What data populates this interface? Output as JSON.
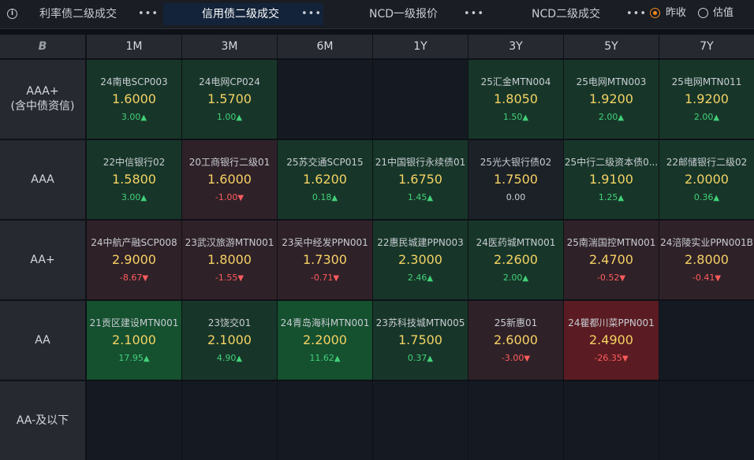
{
  "tabs": [
    {
      "label": "利率债二级成交",
      "more": "•••"
    },
    {
      "label": "信用债二级成交",
      "more": "•••",
      "active": true
    },
    {
      "label": "NCD一级报价",
      "more": "•••"
    },
    {
      "label": "NCD二级成交",
      "more": "•••"
    }
  ],
  "radio": {
    "option1": "昨收",
    "option2": "估值",
    "selected": "昨收"
  },
  "header": {
    "logo": "B",
    "terms": [
      "1M",
      "3M",
      "6M",
      "1Y",
      "3Y",
      "5Y",
      "7Y"
    ]
  },
  "rows": [
    {
      "label_line1": "AAA+",
      "label_line2": "(含中债资信)",
      "cells": [
        {
          "name": "24南电SCP003",
          "rate": "1.6000",
          "change": "3.00",
          "dir": "up"
        },
        {
          "name": "24电网CP024",
          "rate": "1.5700",
          "change": "1.00",
          "dir": "up"
        },
        null,
        null,
        {
          "name": "25汇金MTN004",
          "rate": "1.8050",
          "change": "1.50",
          "dir": "up"
        },
        {
          "name": "25电网MTN003",
          "rate": "1.9200",
          "change": "2.00",
          "dir": "up"
        },
        {
          "name": "25电网MTN011",
          "rate": "1.9200",
          "change": "2.00",
          "dir": "up"
        }
      ]
    },
    {
      "label_line1": "AAA",
      "label_line2": "",
      "cells": [
        {
          "name": "22中信银行02",
          "rate": "1.5800",
          "change": "3.00",
          "dir": "up"
        },
        {
          "name": "20工商银行二级01",
          "rate": "1.6000",
          "change": "-1.00",
          "dir": "down"
        },
        {
          "name": "25苏交通SCP015",
          "rate": "1.6200",
          "change": "0.18",
          "dir": "up"
        },
        {
          "name": "21中国银行永续债01",
          "rate": "1.6750",
          "change": "1.45",
          "dir": "up"
        },
        {
          "name": "25光大银行债02",
          "rate": "1.7500",
          "change": "0.00",
          "dir": "flat"
        },
        {
          "name": "25中行二级资本债0...",
          "rate": "1.9100",
          "change": "1.25",
          "dir": "up"
        },
        {
          "name": "22邮储银行二级02",
          "rate": "2.0000",
          "change": "0.36",
          "dir": "up"
        }
      ]
    },
    {
      "label_line1": "AA+",
      "label_line2": "",
      "cells": [
        {
          "name": "24中航产融SCP008",
          "rate": "2.9000",
          "change": "-8.67",
          "dir": "down"
        },
        {
          "name": "23武汉旅游MTN001",
          "rate": "1.8000",
          "change": "-1.55",
          "dir": "down"
        },
        {
          "name": "23吴中经发PPN001",
          "rate": "1.7300",
          "change": "-0.71",
          "dir": "down"
        },
        {
          "name": "22惠民城建PPN003",
          "rate": "2.3000",
          "change": "2.46",
          "dir": "up"
        },
        {
          "name": "24医药城MTN001",
          "rate": "2.2600",
          "change": "2.00",
          "dir": "up"
        },
        {
          "name": "25南湍国控MTN001",
          "rate": "2.4700",
          "change": "-0.52",
          "dir": "down"
        },
        {
          "name": "24涪陵实业PPN001B",
          "rate": "2.8000",
          "change": "-0.41",
          "dir": "down"
        }
      ]
    },
    {
      "label_line1": "AA",
      "label_line2": "",
      "cells": [
        {
          "name": "21贡区建设MTN001",
          "rate": "2.1000",
          "change": "17.95",
          "dir": "up"
        },
        {
          "name": "23饶交01",
          "rate": "2.1000",
          "change": "4.90",
          "dir": "up"
        },
        {
          "name": "24青岛海科MTN001",
          "rate": "2.2000",
          "change": "11.62",
          "dir": "up"
        },
        {
          "name": "23苏科技城MTN005",
          "rate": "1.7500",
          "change": "0.37",
          "dir": "up"
        },
        {
          "name": "25新惠01",
          "rate": "2.6000",
          "change": "-3.00",
          "dir": "down"
        },
        {
          "name": "24瞿都川菜PPN001",
          "rate": "2.4900",
          "change": "-26.35",
          "dir": "down"
        },
        null
      ]
    },
    {
      "label_line1": "AA-及以下",
      "label_line2": "",
      "cells": [
        null,
        null,
        null,
        null,
        null,
        null,
        null
      ]
    }
  ],
  "colors": {
    "empty": "#151a22",
    "up_light": "#173629",
    "up_strong": "#15502f",
    "down_light": "#2f2128",
    "down_strong": "#5a1c22",
    "flat": "#1c2027"
  }
}
